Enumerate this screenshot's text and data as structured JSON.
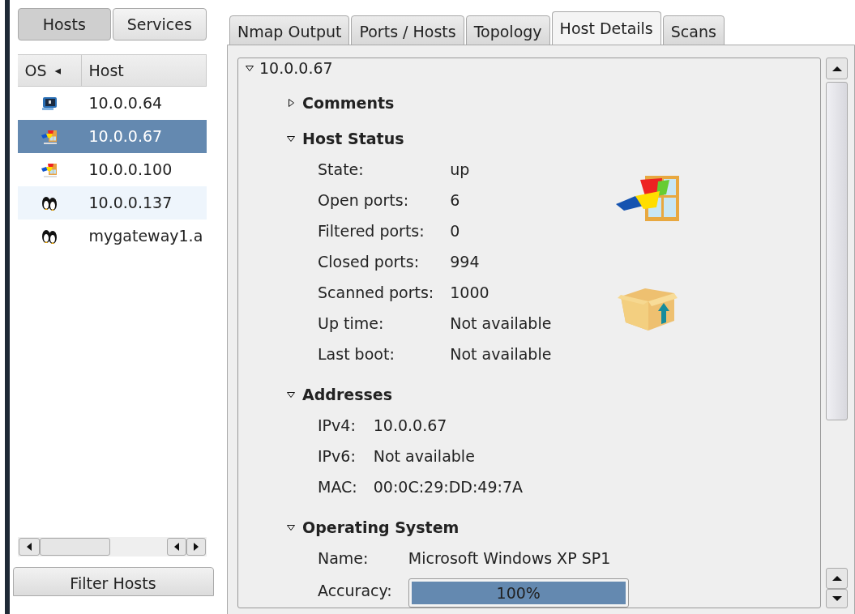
{
  "sidebar": {
    "toggles": [
      {
        "label": "Hosts",
        "selected": true
      },
      {
        "label": "Services",
        "selected": false
      }
    ],
    "columns": [
      {
        "label": "OS",
        "sort_indicator": "◂"
      },
      {
        "label": "Host"
      }
    ],
    "rows": [
      {
        "kind": "unknown",
        "host": "10.0.0.64",
        "selected": false
      },
      {
        "kind": "windows",
        "host": "10.0.0.67",
        "selected": true
      },
      {
        "kind": "windows",
        "host": "10.0.0.100",
        "selected": false
      },
      {
        "kind": "linux",
        "host": "10.0.0.137",
        "selected": false
      },
      {
        "kind": "linux",
        "host": "mygateway1.a",
        "selected": false
      }
    ],
    "filter_button": "Filter Hosts"
  },
  "tabs": [
    {
      "label": "Nmap Output",
      "selected": false
    },
    {
      "label": "Ports / Hosts",
      "selected": false
    },
    {
      "label": "Topology",
      "selected": false
    },
    {
      "label": "Host Details",
      "selected": true
    },
    {
      "label": "Scans",
      "selected": false
    }
  ],
  "host_details": {
    "host": "10.0.0.67",
    "expanded": true,
    "sections": [
      {
        "kind": "comments",
        "title": "Comments",
        "expanded": false
      },
      {
        "kind": "status",
        "title": "Host Status",
        "expanded": true,
        "fields": [
          {
            "label": "State:",
            "value": "up"
          },
          {
            "label": "Open ports:",
            "value": "6"
          },
          {
            "label": "Filtered ports:",
            "value": "0"
          },
          {
            "label": "Closed ports:",
            "value": "994"
          },
          {
            "label": "Scanned ports:",
            "value": "1000"
          },
          {
            "label": "Up time:",
            "value": "Not available"
          },
          {
            "label": "Last boot:",
            "value": "Not available"
          }
        ]
      },
      {
        "kind": "addresses",
        "title": "Addresses",
        "expanded": true,
        "fields": [
          {
            "label": "IPv4:",
            "value": "10.0.0.67"
          },
          {
            "label": "IPv6:",
            "value": "Not available"
          },
          {
            "label": "MAC:",
            "value": "00:0C:29:DD:49:7A"
          }
        ]
      },
      {
        "kind": "os",
        "title": "Operating System",
        "expanded": true,
        "fields": [
          {
            "label": "Name:",
            "value": "Microsoft Windows XP SP1"
          },
          {
            "kind": "meter",
            "label": "Accuracy:",
            "value": "100%",
            "level": 1
          }
        ]
      }
    ]
  }
}
